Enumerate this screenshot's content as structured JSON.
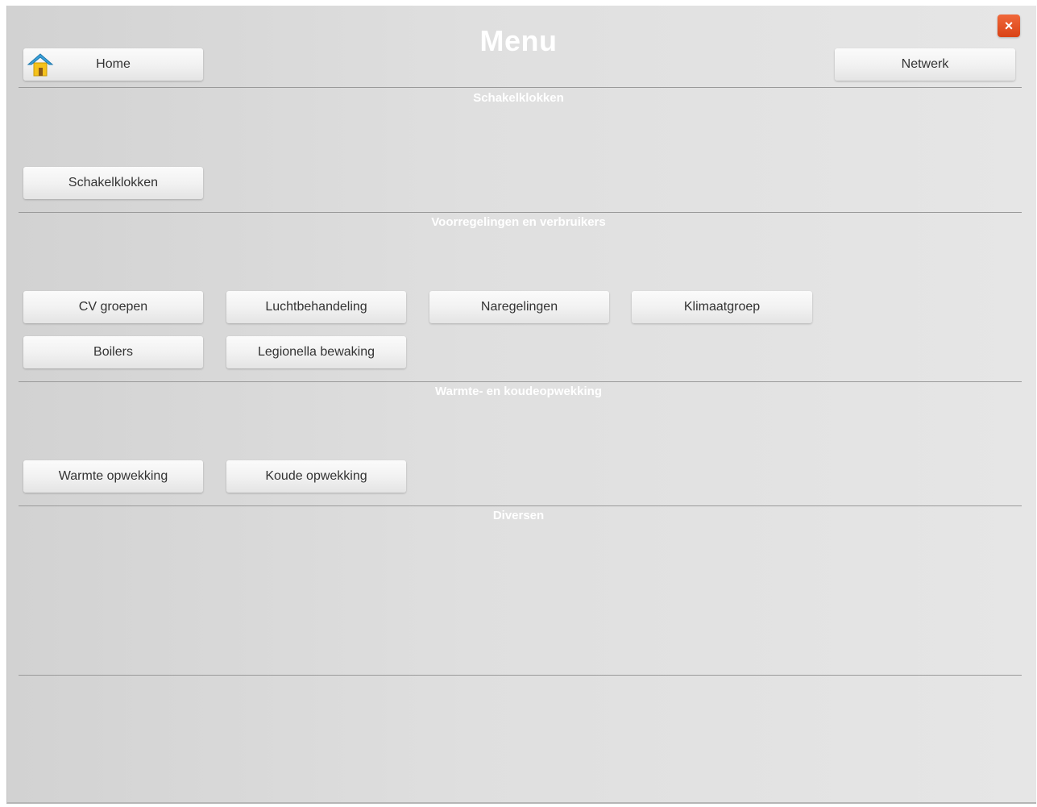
{
  "header": {
    "title": "Menu",
    "home_label": "Home",
    "network_label": "Netwerk",
    "close_label": "×"
  },
  "sections": [
    {
      "label": "Schakelklokken",
      "buttons": [
        "Schakelklokken"
      ]
    },
    {
      "label": "Voorregelingen en verbruikers",
      "buttons": [
        "CV groepen",
        "Luchtbehandeling",
        "Naregelingen",
        "Klimaatgroep",
        "Boilers",
        "Legionella bewaking"
      ]
    },
    {
      "label": "Warmte- en koudeopwekking",
      "buttons": [
        "Warmte opwekking",
        "Koude opwekking"
      ]
    },
    {
      "label": "Diversen",
      "buttons": []
    }
  ],
  "colors": {
    "close_button": "#e0522a",
    "home_icon_roof": "#3aa0d8",
    "home_icon_body": "#f5c21b"
  }
}
